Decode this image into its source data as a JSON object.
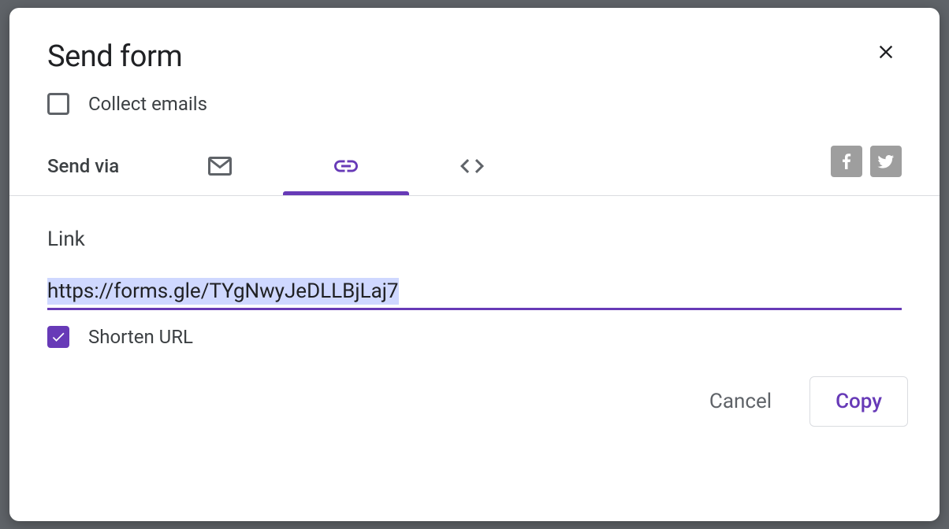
{
  "dialog": {
    "title": "Send form",
    "collectEmailsLabel": "Collect emails",
    "collectEmailsChecked": false,
    "sendViaLabel": "Send via",
    "tabs": [
      "email",
      "link",
      "embed"
    ],
    "activeTab": "link",
    "linkHeading": "Link",
    "linkValue": "https://forms.gle/TYgNwyJeDLLBjLaj7",
    "shortenLabel": "Shorten URL",
    "shortenChecked": true,
    "cancelLabel": "Cancel",
    "copyLabel": "Copy"
  },
  "colors": {
    "accent": "#673ab7",
    "text": "#202124",
    "secondary": "#5f6368"
  }
}
